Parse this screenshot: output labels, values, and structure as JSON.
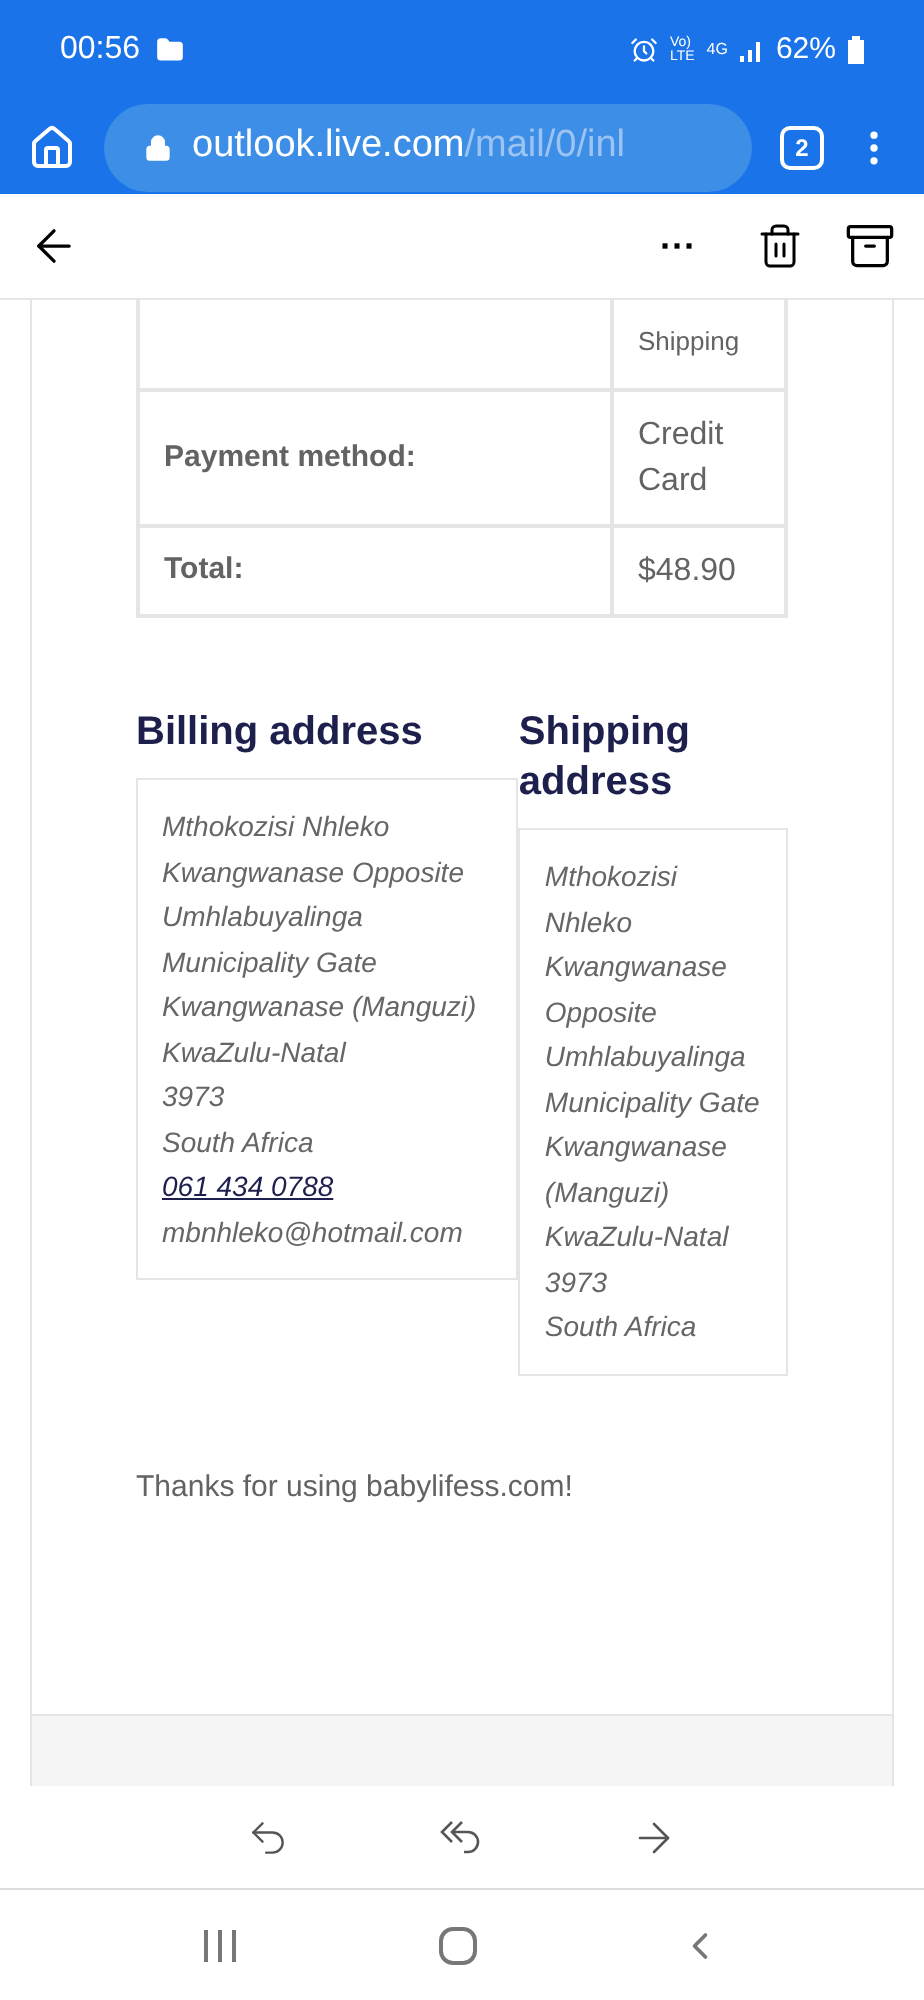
{
  "status_bar": {
    "time": "00:56",
    "volte_top": "Vo)",
    "volte_bottom": "LTE",
    "network": "4G",
    "battery": "62%"
  },
  "browser": {
    "url_host": "outlook.live.com",
    "url_path": "/mail/0/inl",
    "tab_count": "2"
  },
  "toolbar": {
    "more": "···"
  },
  "order_table": {
    "rows": [
      {
        "label": "",
        "value": "Shipping",
        "partial": true
      },
      {
        "label": "Payment method:",
        "value": "Credit Card",
        "partial": false
      },
      {
        "label": "Total:",
        "value": "$48.90",
        "partial": false
      }
    ]
  },
  "billing": {
    "heading": "Billing address",
    "lines": [
      {
        "text": "Mthokozisi Nhleko",
        "kind": "line"
      },
      {
        "text": "Kwangwanase Opposite Umhlabuyalinga Municipality Gate Kwangwanase (Manguzi)",
        "kind": "line"
      },
      {
        "text": "KwaZulu-Natal",
        "kind": "line"
      },
      {
        "text": "3973",
        "kind": "line"
      },
      {
        "text": "South Africa",
        "kind": "line"
      },
      {
        "text": "061 434 0788",
        "kind": "phone"
      },
      {
        "text": "mbnhleko@hotmail.com",
        "kind": "line"
      }
    ]
  },
  "shipping": {
    "heading": "Shipping address",
    "lines": [
      {
        "text": "Mthokozisi Nhleko",
        "kind": "line"
      },
      {
        "text": "Kwangwanase Opposite Umhlabuyalinga Municipality Gate Kwangwanase (Manguzi)",
        "kind": "line"
      },
      {
        "text": "KwaZulu-Natal",
        "kind": "line"
      },
      {
        "text": "3973",
        "kind": "line"
      },
      {
        "text": "South Africa",
        "kind": "line"
      }
    ]
  },
  "thanks": "Thanks for using babylifess.com!"
}
